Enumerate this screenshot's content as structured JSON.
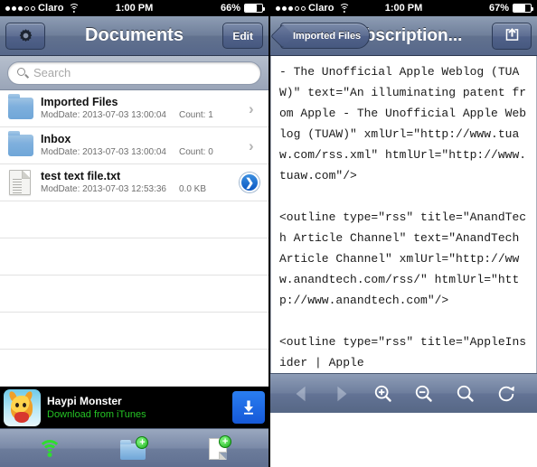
{
  "left": {
    "statusbar": {
      "carrier": "Claro",
      "signal_filled": 3,
      "signal_total": 5,
      "time": "1:00 PM",
      "battery_label": "66%",
      "battery_pct": 66
    },
    "navbar": {
      "title": "Documents",
      "gear_icon": "gear-icon",
      "edit_label": "Edit"
    },
    "search": {
      "placeholder": "Search",
      "value": "",
      "icon": "search-icon"
    },
    "rows": [
      {
        "icon": "folder-icon",
        "title": "Imported Files",
        "moddate": "ModDate: 2013-07-03 13:00:04",
        "meta": "Count: 1",
        "accessory": "chevron-right-icon"
      },
      {
        "icon": "folder-icon",
        "title": "Inbox",
        "moddate": "ModDate: 2013-07-03 13:00:04",
        "meta": "Count: 0",
        "accessory": "chevron-right-icon"
      },
      {
        "icon": "document-icon",
        "title": "test text file.txt",
        "moddate": "ModDate: 2013-07-03 12:53:36",
        "meta": "0.0 KB",
        "accessory": "blue-detail-arrow-icon"
      }
    ],
    "empty_rows": 5,
    "ad": {
      "title": "Haypi Monster",
      "subtitle": "Download from iTunes",
      "subtitle_color": "#25c425",
      "download_icon": "download-arrow-icon",
      "app_icon": "haypi-monster-app-icon"
    },
    "toolbar": [
      {
        "icon": "wifi-icon",
        "color": "#2ede2e"
      },
      {
        "icon": "add-folder-icon"
      },
      {
        "icon": "add-file-icon"
      }
    ]
  },
  "right": {
    "statusbar": {
      "carrier": "Claro",
      "signal_filled": 3,
      "signal_total": 5,
      "time": "1:00 PM",
      "battery_label": "67%",
      "battery_pct": 67
    },
    "navbar": {
      "back_label": "Imported Files",
      "title": "subscription...",
      "share_icon": "share-icon"
    },
    "document_text": "- The Unofficial Apple Weblog (TUAW)\" text=\"An illuminating patent from Apple - The Unofficial Apple Weblog (TUAW)\" xmlUrl=\"http://www.tuaw.com/rss.xml\" htmlUrl=\"http://www.tuaw.com\"/>\n\n<outline type=\"rss\" title=\"AnandTech Article Channel\" text=\"AnandTech Article Channel\" xmlUrl=\"http://www.anandtech.com/rss/\" htmlUrl=\"http://www.anandtech.com\"/>\n\n<outline type=\"rss\" title=\"AppleInsider | Apple",
    "toolbar": [
      {
        "icon": "back-arrow-icon",
        "enabled": false
      },
      {
        "icon": "forward-arrow-icon",
        "enabled": false
      },
      {
        "icon": "zoom-in-icon",
        "enabled": true
      },
      {
        "icon": "zoom-out-icon",
        "enabled": true
      },
      {
        "icon": "search-icon",
        "enabled": true
      },
      {
        "icon": "refresh-icon",
        "enabled": true
      }
    ]
  }
}
